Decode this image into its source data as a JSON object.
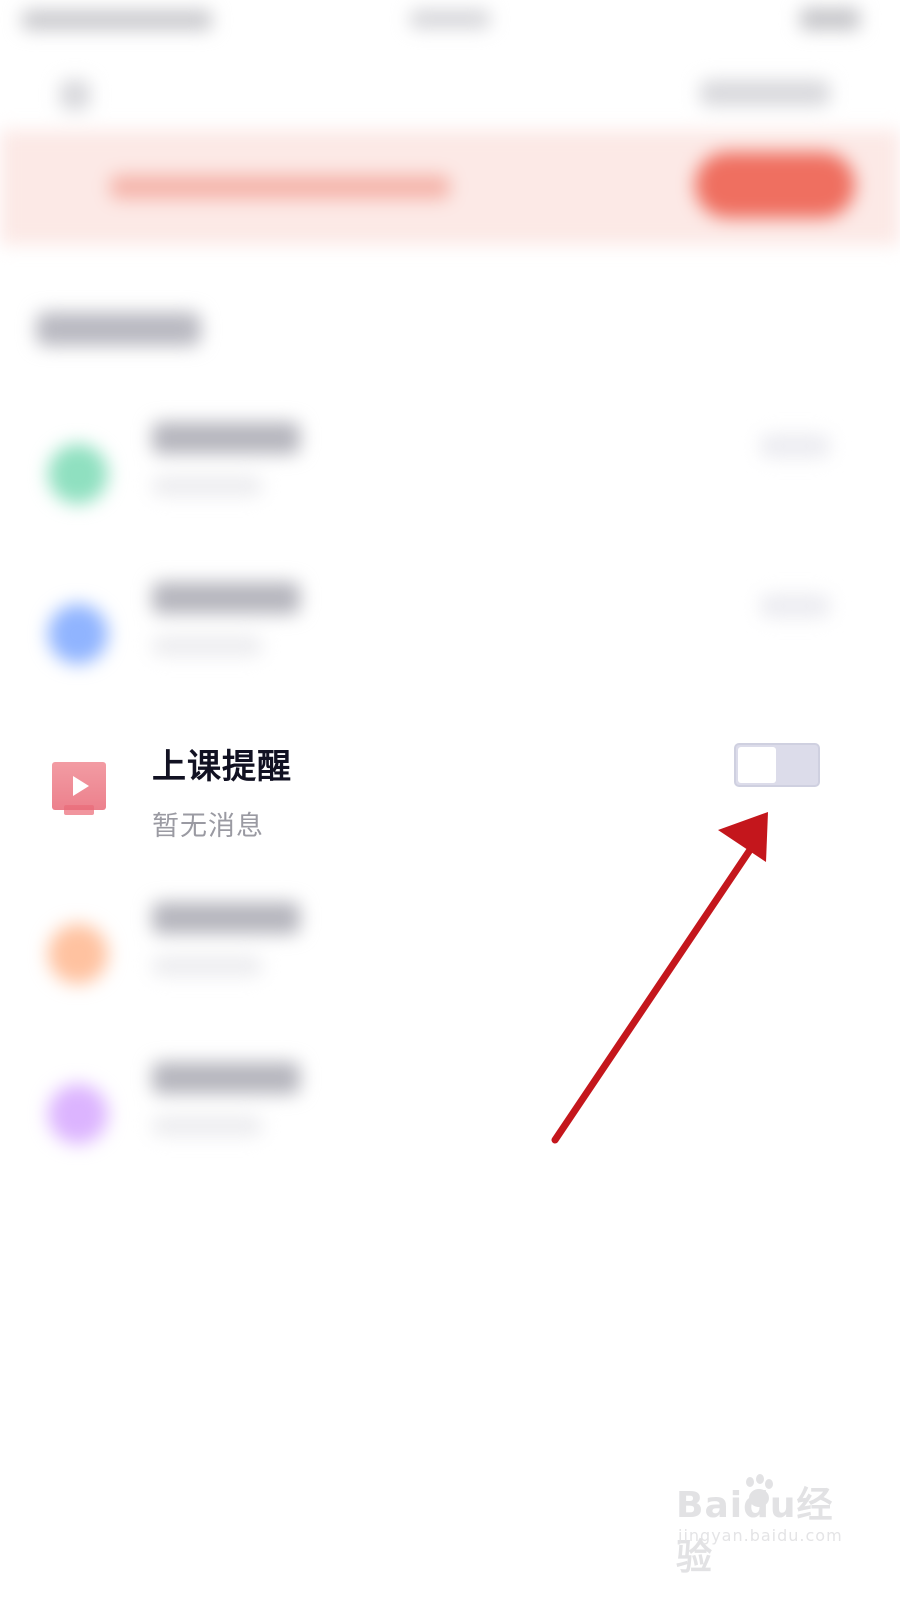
{
  "reminder_row": {
    "title": "上课提醒",
    "subtitle": "暂无消息",
    "toggle_on": false,
    "icon": "play-icon"
  },
  "watermark": {
    "logo": "Baidu经验",
    "url": "jingyan.baidu.com"
  },
  "colors": {
    "arrow": "#c4161c",
    "banner_background": "#fce9e6",
    "banner_button": "#ef6f60",
    "row_icon": "#e96a78",
    "toggle_track": "#dcdcea"
  },
  "blurred_row_icon_colors": [
    "#8fe0c0",
    "#90b4ff",
    "#ffc2a0",
    "#dcb4ff"
  ]
}
